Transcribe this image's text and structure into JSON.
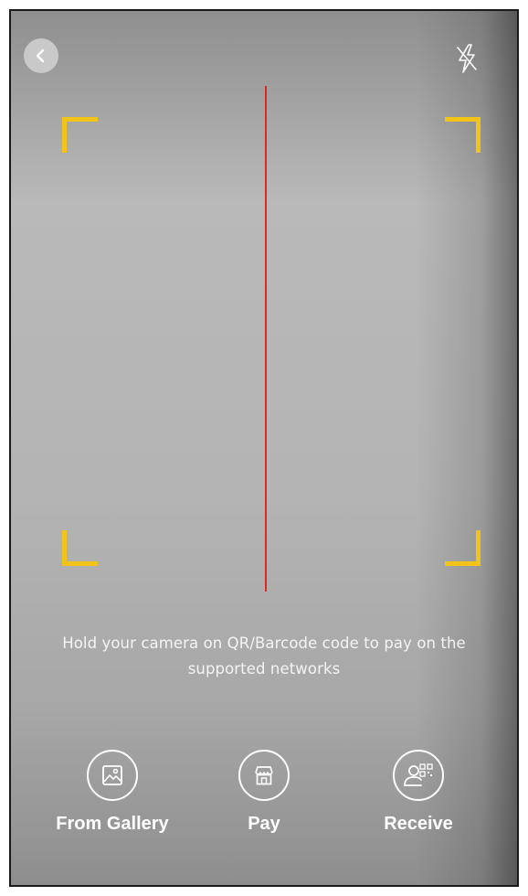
{
  "header": {
    "back_icon": "chevron-left-icon",
    "flash_icon": "flash-off-icon"
  },
  "scanner": {
    "corner_color": "#f2c318",
    "scan_line_color": "#e0281c"
  },
  "instruction": "Hold your camera on QR/Barcode code to pay on the supported networks",
  "actions": [
    {
      "label": "From Gallery",
      "icon": "gallery-image-icon"
    },
    {
      "label": "Pay",
      "icon": "storefront-icon"
    },
    {
      "label": "Receive",
      "icon": "user-qr-code-icon"
    }
  ]
}
